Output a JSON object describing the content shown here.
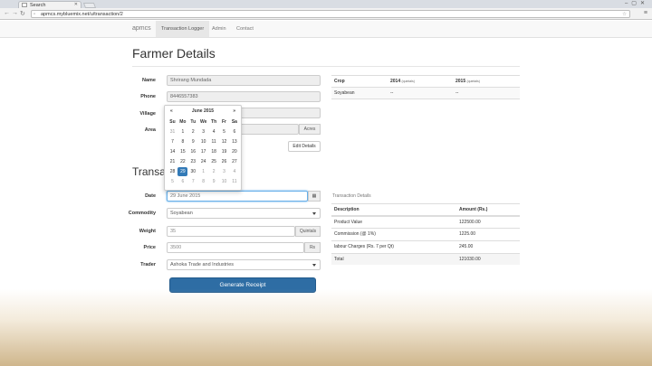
{
  "browser": {
    "tab_title": "Search",
    "url": "apmcs.mybluemix.net/u/transaction/2"
  },
  "nav": {
    "brand": "apmcs",
    "links": [
      "Transaction Logger",
      "Admin",
      "Contact"
    ]
  },
  "page": {
    "title": "Farmer Details",
    "section2_title": "Transac"
  },
  "farmer": {
    "name_label": "Name",
    "name_value": "Shrirang Mundada",
    "phone_label": "Phone",
    "phone_value": "8446557383",
    "village_label": "Village",
    "area_label": "Area",
    "area_unit": "Acres",
    "edit_button": "Edit Details"
  },
  "crop_table": {
    "headers": [
      "Crop",
      "2014",
      "2015"
    ],
    "header_units": [
      "",
      "(quintals)",
      "(quintals)"
    ],
    "rows": [
      [
        "Soyabean",
        "--",
        "--"
      ]
    ]
  },
  "datepicker": {
    "month": "June 2015",
    "prev": "«",
    "next": "»",
    "days_of_week": [
      "Su",
      "Mo",
      "Tu",
      "We",
      "Th",
      "Fr",
      "Sa"
    ],
    "weeks": [
      [
        "31",
        "1",
        "2",
        "3",
        "4",
        "5",
        "6"
      ],
      [
        "7",
        "8",
        "9",
        "10",
        "11",
        "12",
        "13"
      ],
      [
        "14",
        "15",
        "16",
        "17",
        "18",
        "19",
        "20"
      ],
      [
        "21",
        "22",
        "23",
        "24",
        "25",
        "26",
        "27"
      ],
      [
        "28",
        "29",
        "30",
        "1",
        "2",
        "3",
        "4"
      ],
      [
        "5",
        "6",
        "7",
        "8",
        "9",
        "10",
        "11"
      ]
    ],
    "selected": "29"
  },
  "transaction": {
    "date_label": "Date",
    "date_value": "29 June 2015",
    "commodity_label": "Commodity",
    "commodity_value": "Soyabean",
    "weight_label": "Weight",
    "weight_value": "35",
    "weight_unit": "Quintals",
    "price_label": "Price",
    "price_value": "3500",
    "price_unit": "Rs",
    "trader_label": "Trader",
    "trader_value": "Ashoka Trade and Industries",
    "generate_button": "Generate Receipt",
    "calendar_icon": "calendar-icon"
  },
  "details": {
    "caption": "Transaction Details",
    "headers": [
      "Description",
      "Amount (Rs.)"
    ],
    "rows": [
      [
        "Product Value",
        "122500.00"
      ],
      [
        "Commission (@ 1%)",
        "1225.00"
      ],
      [
        "labour Charges (Rs. 7 per Qt)",
        "245.00"
      ],
      [
        "Total",
        "121030.00"
      ]
    ]
  }
}
